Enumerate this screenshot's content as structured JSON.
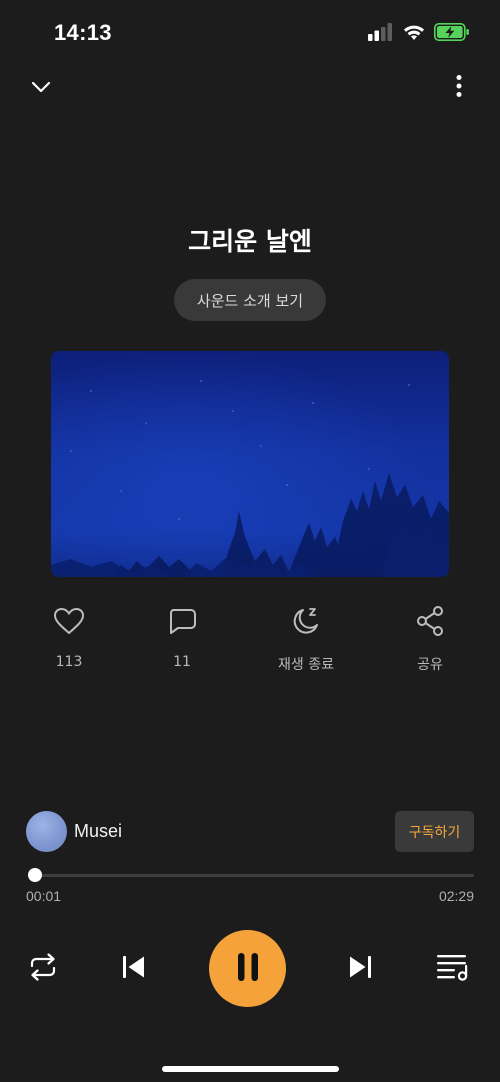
{
  "status_bar": {
    "time": "14:13",
    "signal_icon": "cellular-signal-icon",
    "wifi_icon": "wifi-icon",
    "battery_icon": "battery-charging-icon"
  },
  "top_bar": {
    "collapse_icon": "chevron-down-icon",
    "more_icon": "more-vertical-icon"
  },
  "track": {
    "title": "그리운 날엔",
    "intro_button_label": "사운드 소개 보기"
  },
  "actions": [
    {
      "icon": "heart-icon",
      "label": "113"
    },
    {
      "icon": "comment-icon",
      "label": "11"
    },
    {
      "icon": "sleep-timer-icon",
      "label": "재생 종료"
    },
    {
      "icon": "share-icon",
      "label": "공유"
    }
  ],
  "artist": {
    "name": "Musei",
    "subscribe_label": "구독하기"
  },
  "progress": {
    "elapsed": "00:01",
    "duration": "02:29",
    "fraction": 0.007
  },
  "controls": {
    "repeat_icon": "repeat-icon",
    "previous_icon": "skip-previous-icon",
    "pause_icon": "pause-icon",
    "next_icon": "skip-next-icon",
    "playlist_icon": "playlist-icon"
  },
  "colors": {
    "background": "#1c1c1c",
    "accent": "#f5a23b",
    "battery": "#55d35a"
  }
}
